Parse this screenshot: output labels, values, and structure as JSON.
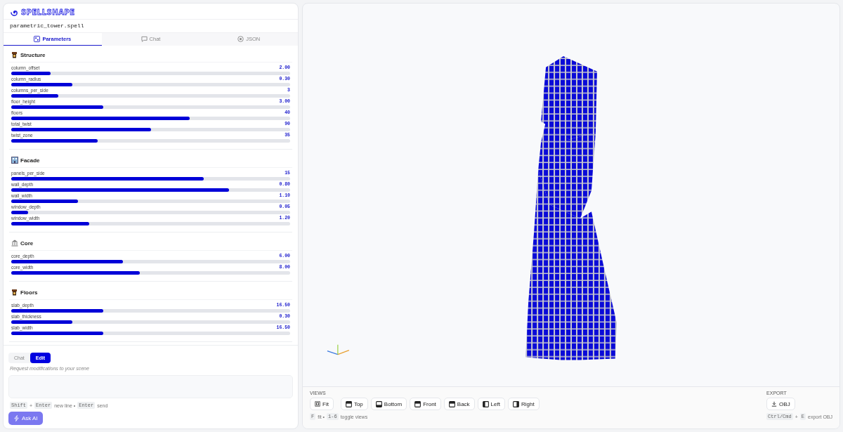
{
  "app": {
    "logo": "SPELLSHAPE",
    "filename": "parametric_tower.spell"
  },
  "tabs": [
    {
      "label": "Parameters",
      "selected": true
    },
    {
      "label": "Chat",
      "selected": false
    },
    {
      "label": "JSON",
      "selected": false
    }
  ],
  "sections": [
    {
      "title": "Structure",
      "params": [
        {
          "name": "column_offset",
          "value": "2.00",
          "level": 0.14
        },
        {
          "name": "column_radius",
          "value": "0.30",
          "level": 0.22
        },
        {
          "name": "columns_per_side",
          "value": "3",
          "level": 0.17
        },
        {
          "name": "floor_height",
          "value": "3.00",
          "level": 0.33
        },
        {
          "name": "floors",
          "value": "40",
          "level": 0.64
        },
        {
          "name": "total_twist",
          "value": "90",
          "level": 0.5
        },
        {
          "name": "twist_zone",
          "value": "35",
          "level": 0.31
        }
      ]
    },
    {
      "title": "Facade",
      "params": [
        {
          "name": "panels_per_side",
          "value": "15",
          "level": 0.69
        },
        {
          "name": "wall_depth",
          "value": "0.80",
          "level": 0.78
        },
        {
          "name": "wall_width",
          "value": "1.10",
          "level": 0.24
        },
        {
          "name": "window_depth",
          "value": "0.05",
          "level": 0.06
        },
        {
          "name": "window_width",
          "value": "1.20",
          "level": 0.28
        }
      ]
    },
    {
      "title": "Core",
      "params": [
        {
          "name": "core_depth",
          "value": "6.00",
          "level": 0.4
        },
        {
          "name": "core_width",
          "value": "8.00",
          "level": 0.46
        }
      ]
    },
    {
      "title": "Floors",
      "params": [
        {
          "name": "slab_depth",
          "value": "16.50",
          "level": 0.33
        },
        {
          "name": "slab_thickness",
          "value": "0.30",
          "level": 0.22
        },
        {
          "name": "slab_width",
          "value": "16.50",
          "level": 0.33
        }
      ]
    }
  ],
  "chat": {
    "modes": [
      {
        "label": "Chat",
        "selected": false
      },
      {
        "label": "Edit",
        "selected": true
      }
    ],
    "hint": "Request modifications to your scene",
    "shortcuts": [
      {
        "kind": "key",
        "text": "Shift"
      },
      {
        "kind": "text",
        "text": "+"
      },
      {
        "kind": "key",
        "text": "Enter"
      },
      {
        "kind": "text",
        "text": "new line •"
      },
      {
        "kind": "key",
        "text": "Enter"
      },
      {
        "kind": "text",
        "text": "send"
      }
    ],
    "ask_button": "Ask AI"
  },
  "views": {
    "label": "VIEWS",
    "buttons": [
      "Fit",
      "Top",
      "Bottom",
      "Front",
      "Back",
      "Left",
      "Right"
    ],
    "shortcuts": [
      {
        "kind": "key",
        "text": "F"
      },
      {
        "kind": "text",
        "text": "fit •"
      },
      {
        "kind": "key",
        "text": "1-6"
      },
      {
        "kind": "text",
        "text": "toggle views"
      }
    ]
  },
  "export": {
    "label": "EXPORT",
    "button": "OBJ",
    "shortcuts": [
      {
        "kind": "key",
        "text": "Ctrl/Cmd"
      },
      {
        "kind": "text",
        "text": "+"
      },
      {
        "kind": "key",
        "text": "E"
      },
      {
        "kind": "text",
        "text": "export OBJ"
      }
    ]
  }
}
